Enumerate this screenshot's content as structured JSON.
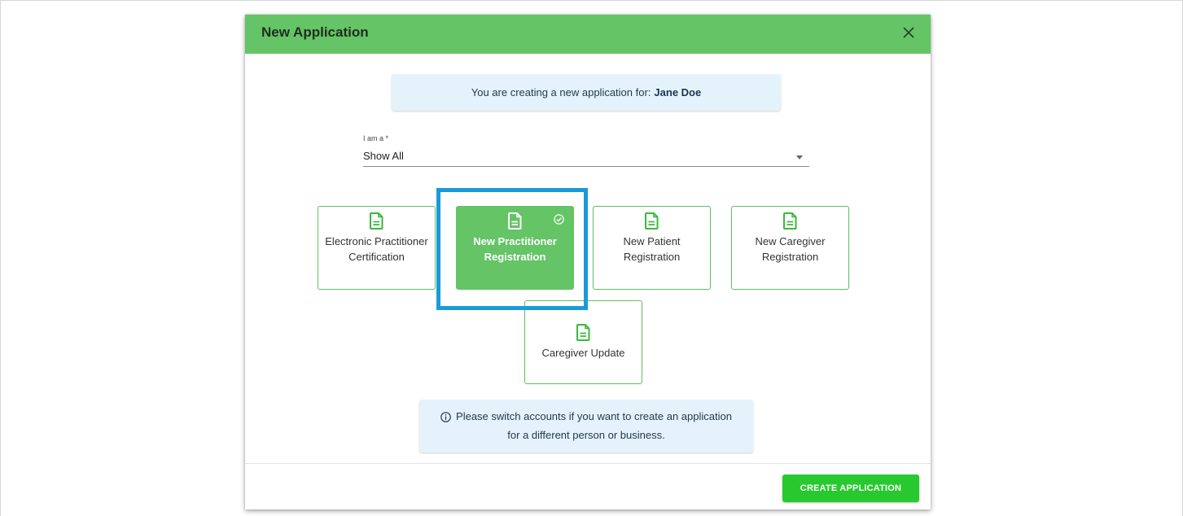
{
  "dialog": {
    "title": "New Application"
  },
  "banner": {
    "prefix": "You are creating a new application for:",
    "name": "Jane Doe"
  },
  "role_select": {
    "label": "I am a *",
    "value": "Show All"
  },
  "cards": [
    {
      "label": "Electronic Practitioner Certification",
      "icon": "document-icon",
      "selected": false
    },
    {
      "label": "New Practitioner Registration",
      "icon": "document-icon",
      "selected": true
    },
    {
      "label": "New Patient Registration",
      "icon": "document-icon",
      "selected": false
    },
    {
      "label": "New Caregiver Registration",
      "icon": "document-icon",
      "selected": false
    },
    {
      "label": "Caregiver Update",
      "icon": "document-icon",
      "selected": false
    }
  ],
  "note": {
    "text": "Please switch accounts if you want to create an application for a different person or business."
  },
  "footer": {
    "create_label": "CREATE APPLICATION"
  },
  "colors": {
    "header_green": "#65c466",
    "button_green": "#27c92f",
    "highlight_blue": "#1a9bd7",
    "info_bg": "#e4f3fb"
  }
}
